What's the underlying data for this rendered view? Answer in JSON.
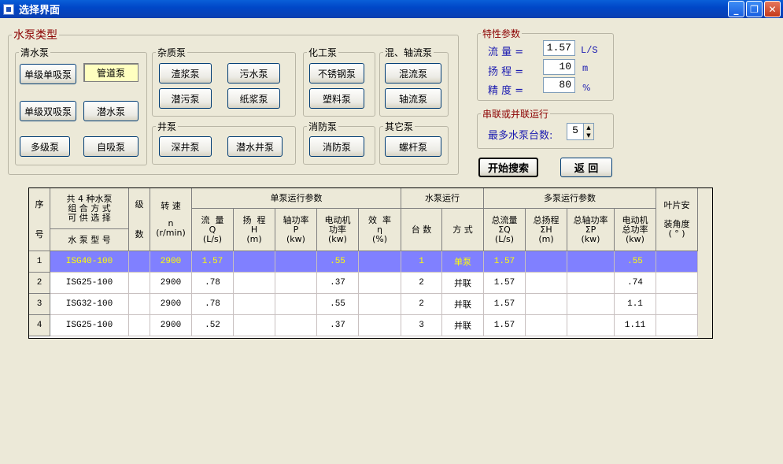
{
  "window": {
    "title": "选择界面"
  },
  "pump_types": {
    "legend": "水泵类型",
    "clear_water": {
      "legend": "清水泵",
      "buttons": [
        "单级单吸泵",
        "管道泵",
        "单级双吸泵",
        "潜水泵",
        "多级泵",
        "自吸泵"
      ],
      "selected": "管道泵"
    },
    "impurity": {
      "legend": "杂质泵",
      "buttons": [
        "渣浆泵",
        "污水泵",
        "潜污泵",
        "纸浆泵"
      ]
    },
    "chemical": {
      "legend": "化工泵",
      "buttons": [
        "不锈钢泵",
        "塑料泵"
      ]
    },
    "mixed_axial": {
      "legend": "混、轴流泵",
      "buttons": [
        "混流泵",
        "轴流泵"
      ]
    },
    "well": {
      "legend": "井泵",
      "buttons": [
        "深井泵",
        "潜水井泵"
      ]
    },
    "fire": {
      "legend": "消防泵",
      "buttons": [
        "消防泵"
      ]
    },
    "other": {
      "legend": "其它泵",
      "buttons": [
        "螺杆泵"
      ]
    }
  },
  "params": {
    "legend": "特性参数",
    "flow": {
      "label": "流  量 =",
      "value": "1.57",
      "unit": "L/S"
    },
    "head": {
      "label": "扬  程 =",
      "value": "10",
      "unit": "m"
    },
    "precision": {
      "label": "精  度 =",
      "value": "80",
      "unit": "%"
    }
  },
  "series_parallel": {
    "legend": "串联或并联运行",
    "label": "最多水泵台数:",
    "value": "5"
  },
  "actions": {
    "search": "开始搜索",
    "back": "返  回"
  },
  "table": {
    "headers": {
      "seq_top": "序",
      "seq_bottom": "号",
      "combo": "共 4 种水泵\n组 合 方 式\n可 供 选 择",
      "model": "水 泵 型 号",
      "stage_top": "级",
      "stage_bottom": "数",
      "speed_top": "转  速",
      "speed_bottom": "n\n(r/min)",
      "single": "单泵运行参数",
      "flow": "流  量\nQ\n(L/s)",
      "head": "扬  程\nH\n(m)",
      "shaft": "轴功率\nP\n(kw)",
      "motor": "电动机\n功率\n(kw)",
      "eff": "效  率\nη\n(%)",
      "operation": "水泵运行",
      "count": "台  数",
      "mode": "方  式",
      "multi": "多泵运行参数",
      "tflow": "总流量\nΣQ\n(L/s)",
      "thead": "总扬程\nΣH\n(m)",
      "tshaft": "总轴功率\nΣP\n(kw)",
      "tmotor": "电动机\n总功率\n(kw)",
      "blade_top": "叶片安",
      "blade_bottom": "装角度\n( ° )"
    },
    "rows": [
      {
        "n": "1",
        "model": "ISG40-100",
        "stage": "",
        "speed": "2900",
        "flow": "1.57",
        "head": "",
        "shaft": "",
        "motor": ".55",
        "eff": "",
        "count": "1",
        "mode": "单泵",
        "tflow": "1.57",
        "thead": "",
        "tshaft": "",
        "tmotor": ".55",
        "blade": ""
      },
      {
        "n": "2",
        "model": "ISG25-100",
        "stage": "",
        "speed": "2900",
        "flow": ".78",
        "head": "",
        "shaft": "",
        "motor": ".37",
        "eff": "",
        "count": "2",
        "mode": "并联",
        "tflow": "1.57",
        "thead": "",
        "tshaft": "",
        "tmotor": ".74",
        "blade": ""
      },
      {
        "n": "3",
        "model": "ISG32-100",
        "stage": "",
        "speed": "2900",
        "flow": ".78",
        "head": "",
        "shaft": "",
        "motor": ".55",
        "eff": "",
        "count": "2",
        "mode": "并联",
        "tflow": "1.57",
        "thead": "",
        "tshaft": "",
        "tmotor": "1.1",
        "blade": ""
      },
      {
        "n": "4",
        "model": "ISG25-100",
        "stage": "",
        "speed": "2900",
        "flow": ".52",
        "head": "",
        "shaft": "",
        "motor": ".37",
        "eff": "",
        "count": "3",
        "mode": "并联",
        "tflow": "1.57",
        "thead": "",
        "tshaft": "",
        "tmotor": "1.11",
        "blade": ""
      }
    ]
  }
}
